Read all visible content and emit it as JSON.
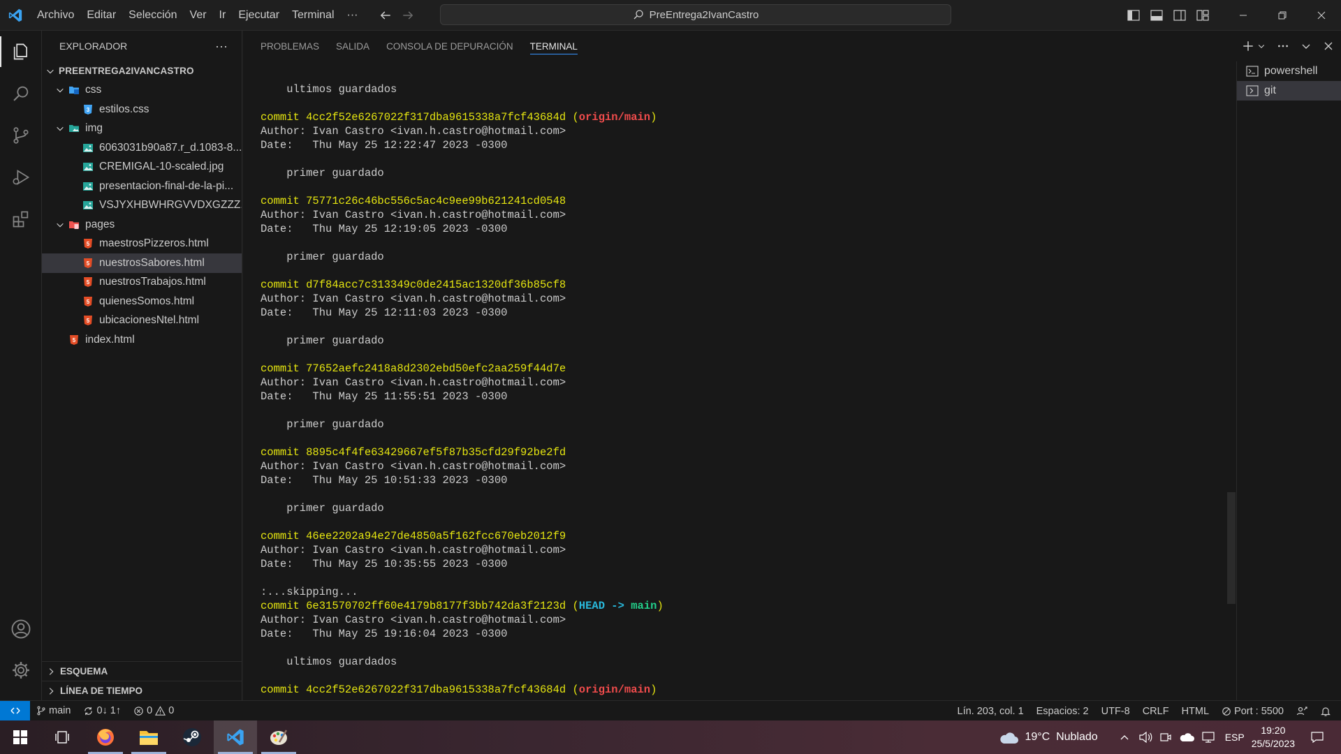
{
  "titlebar": {
    "menu": [
      "Archivo",
      "Editar",
      "Selección",
      "Ver",
      "Ir",
      "Ejecutar",
      "Terminal",
      "···"
    ],
    "search": "PreEntrega2IvanCastro"
  },
  "sidebar": {
    "title": "EXPLORADOR",
    "more": "···",
    "root": "PREENTREGA2IVANCASTRO",
    "tree": [
      {
        "label": "css",
        "depth": 1,
        "kind": "folder-css",
        "open": true
      },
      {
        "label": "estilos.css",
        "depth": 2,
        "kind": "css"
      },
      {
        "label": "img",
        "depth": 1,
        "kind": "folder-img",
        "open": true
      },
      {
        "label": "6063031b90a87.r_d.1083-8...",
        "depth": 2,
        "kind": "image"
      },
      {
        "label": "CREMIGAL-10-scaled.jpg",
        "depth": 2,
        "kind": "image"
      },
      {
        "label": "presentacion-final-de-la-pi...",
        "depth": 2,
        "kind": "image"
      },
      {
        "label": "VSJYXHBWHRGVVDXGZZZ...",
        "depth": 2,
        "kind": "image"
      },
      {
        "label": "pages",
        "depth": 1,
        "kind": "folder-pages",
        "open": true
      },
      {
        "label": "maestrosPizzeros.html",
        "depth": 2,
        "kind": "html"
      },
      {
        "label": "nuestrosSabores.html",
        "depth": 2,
        "kind": "html",
        "selected": true
      },
      {
        "label": "nuestrosTrabajos.html",
        "depth": 2,
        "kind": "html"
      },
      {
        "label": "quienesSomos.html",
        "depth": 2,
        "kind": "html"
      },
      {
        "label": "ubicacionesNtel.html",
        "depth": 2,
        "kind": "html"
      },
      {
        "label": "index.html",
        "depth": 1,
        "kind": "html"
      }
    ],
    "outline": "ESQUEMA",
    "timeline": "LÍNEA DE TIEMPO"
  },
  "panel": {
    "tabs": [
      "PROBLEMAS",
      "SALIDA",
      "CONSOLA DE DEPURACIÓN",
      "TERMINAL"
    ],
    "active_tab": "TERMINAL"
  },
  "terminal": {
    "lines": [
      [
        {
          "t": "    ultimos guardados"
        }
      ],
      [
        {
          "t": ""
        }
      ],
      [
        {
          "t": "commit 4cc2f52e6267022f317dba9615338a7fcf43684d ",
          "c": "y"
        },
        {
          "t": "(",
          "c": "y"
        },
        {
          "t": "origin/main",
          "c": "r"
        },
        {
          "t": ")",
          "c": "y"
        }
      ],
      [
        {
          "t": "Author: Ivan Castro <ivan.h.castro@hotmail.com>"
        }
      ],
      [
        {
          "t": "Date:   Thu May 25 12:22:47 2023 -0300"
        }
      ],
      [
        {
          "t": ""
        }
      ],
      [
        {
          "t": "    primer guardado"
        }
      ],
      [
        {
          "t": ""
        }
      ],
      [
        {
          "t": "commit 75771c26c46bc556c5ac4c9ee99b621241cd0548",
          "c": "y"
        }
      ],
      [
        {
          "t": "Author: Ivan Castro <ivan.h.castro@hotmail.com>"
        }
      ],
      [
        {
          "t": "Date:   Thu May 25 12:19:05 2023 -0300"
        }
      ],
      [
        {
          "t": ""
        }
      ],
      [
        {
          "t": "    primer guardado"
        }
      ],
      [
        {
          "t": ""
        }
      ],
      [
        {
          "t": "commit d7f84acc7c313349c0de2415ac1320df36b85cf8",
          "c": "y"
        }
      ],
      [
        {
          "t": "Author: Ivan Castro <ivan.h.castro@hotmail.com>"
        }
      ],
      [
        {
          "t": "Date:   Thu May 25 12:11:03 2023 -0300"
        }
      ],
      [
        {
          "t": ""
        }
      ],
      [
        {
          "t": "    primer guardado"
        }
      ],
      [
        {
          "t": ""
        }
      ],
      [
        {
          "t": "commit 77652aefc2418a8d2302ebd50efc2aa259f44d7e",
          "c": "y"
        }
      ],
      [
        {
          "t": "Author: Ivan Castro <ivan.h.castro@hotmail.com>"
        }
      ],
      [
        {
          "t": "Date:   Thu May 25 11:55:51 2023 -0300"
        }
      ],
      [
        {
          "t": ""
        }
      ],
      [
        {
          "t": "    primer guardado"
        }
      ],
      [
        {
          "t": ""
        }
      ],
      [
        {
          "t": "commit 8895c4f4fe63429667ef5f87b35cfd29f92be2fd",
          "c": "y"
        }
      ],
      [
        {
          "t": "Author: Ivan Castro <ivan.h.castro@hotmail.com>"
        }
      ],
      [
        {
          "t": "Date:   Thu May 25 10:51:33 2023 -0300"
        }
      ],
      [
        {
          "t": ""
        }
      ],
      [
        {
          "t": "    primer guardado"
        }
      ],
      [
        {
          "t": ""
        }
      ],
      [
        {
          "t": "commit 46ee2202a94e27de4850a5f162fcc670eb2012f9",
          "c": "y"
        }
      ],
      [
        {
          "t": "Author: Ivan Castro <ivan.h.castro@hotmail.com>"
        }
      ],
      [
        {
          "t": "Date:   Thu May 25 10:35:55 2023 -0300"
        }
      ],
      [
        {
          "t": ""
        }
      ],
      [
        {
          "t": ":...skipping..."
        }
      ],
      [
        {
          "t": "commit 6e31570702ff60e4179b8177f3bb742da3f2123d ",
          "c": "y"
        },
        {
          "t": "(",
          "c": "y"
        },
        {
          "t": "HEAD -> ",
          "c": "c"
        },
        {
          "t": "main",
          "c": "g"
        },
        {
          "t": ")",
          "c": "y"
        }
      ],
      [
        {
          "t": "Author: Ivan Castro <ivan.h.castro@hotmail.com>"
        }
      ],
      [
        {
          "t": "Date:   Thu May 25 19:16:04 2023 -0300"
        }
      ],
      [
        {
          "t": ""
        }
      ],
      [
        {
          "t": "    ultimos guardados"
        }
      ],
      [
        {
          "t": ""
        }
      ],
      [
        {
          "t": "commit 4cc2f52e6267022f317dba9615338a7fcf43684d ",
          "c": "y"
        },
        {
          "t": "(",
          "c": "y"
        },
        {
          "t": "origin/main",
          "c": "r"
        },
        {
          "t": ")",
          "c": "y"
        }
      ]
    ],
    "colors": {
      "y": "#e5e510",
      "r": "#f14c4c",
      "c": "#29b8db",
      "g": "#23d18b"
    }
  },
  "terminal_list": [
    {
      "label": "powershell",
      "selected": false
    },
    {
      "label": "git",
      "selected": true
    }
  ],
  "statusbar": {
    "branch": "main",
    "sync": "0↓ 1↑",
    "errors": "0",
    "warnings": "0",
    "position": "Lín. 203, col. 1",
    "spaces": "Espacios: 2",
    "encoding": "UTF-8",
    "eol": "CRLF",
    "language": "HTML",
    "port": "Port : 5500"
  },
  "taskbar": {
    "apps": [
      "windows-start",
      "task-view",
      "firefox",
      "file-explorer",
      "steam",
      "vscode",
      "paint-app"
    ],
    "weather": "19°C  Nublado",
    "lang": "ESP",
    "time": "19:20",
    "date": "25/5/2023"
  }
}
